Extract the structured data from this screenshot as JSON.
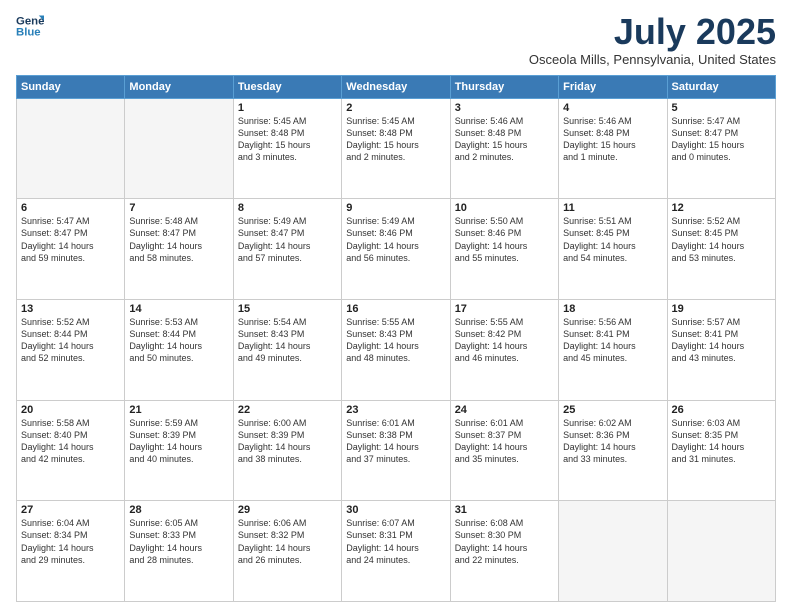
{
  "logo": {
    "line1": "General",
    "line2": "Blue"
  },
  "title": "July 2025",
  "location": "Osceola Mills, Pennsylvania, United States",
  "days_of_week": [
    "Sunday",
    "Monday",
    "Tuesday",
    "Wednesday",
    "Thursday",
    "Friday",
    "Saturday"
  ],
  "weeks": [
    [
      {
        "day": "",
        "info": ""
      },
      {
        "day": "",
        "info": ""
      },
      {
        "day": "1",
        "info": "Sunrise: 5:45 AM\nSunset: 8:48 PM\nDaylight: 15 hours\nand 3 minutes."
      },
      {
        "day": "2",
        "info": "Sunrise: 5:45 AM\nSunset: 8:48 PM\nDaylight: 15 hours\nand 2 minutes."
      },
      {
        "day": "3",
        "info": "Sunrise: 5:46 AM\nSunset: 8:48 PM\nDaylight: 15 hours\nand 2 minutes."
      },
      {
        "day": "4",
        "info": "Sunrise: 5:46 AM\nSunset: 8:48 PM\nDaylight: 15 hours\nand 1 minute."
      },
      {
        "day": "5",
        "info": "Sunrise: 5:47 AM\nSunset: 8:47 PM\nDaylight: 15 hours\nand 0 minutes."
      }
    ],
    [
      {
        "day": "6",
        "info": "Sunrise: 5:47 AM\nSunset: 8:47 PM\nDaylight: 14 hours\nand 59 minutes."
      },
      {
        "day": "7",
        "info": "Sunrise: 5:48 AM\nSunset: 8:47 PM\nDaylight: 14 hours\nand 58 minutes."
      },
      {
        "day": "8",
        "info": "Sunrise: 5:49 AM\nSunset: 8:47 PM\nDaylight: 14 hours\nand 57 minutes."
      },
      {
        "day": "9",
        "info": "Sunrise: 5:49 AM\nSunset: 8:46 PM\nDaylight: 14 hours\nand 56 minutes."
      },
      {
        "day": "10",
        "info": "Sunrise: 5:50 AM\nSunset: 8:46 PM\nDaylight: 14 hours\nand 55 minutes."
      },
      {
        "day": "11",
        "info": "Sunrise: 5:51 AM\nSunset: 8:45 PM\nDaylight: 14 hours\nand 54 minutes."
      },
      {
        "day": "12",
        "info": "Sunrise: 5:52 AM\nSunset: 8:45 PM\nDaylight: 14 hours\nand 53 minutes."
      }
    ],
    [
      {
        "day": "13",
        "info": "Sunrise: 5:52 AM\nSunset: 8:44 PM\nDaylight: 14 hours\nand 52 minutes."
      },
      {
        "day": "14",
        "info": "Sunrise: 5:53 AM\nSunset: 8:44 PM\nDaylight: 14 hours\nand 50 minutes."
      },
      {
        "day": "15",
        "info": "Sunrise: 5:54 AM\nSunset: 8:43 PM\nDaylight: 14 hours\nand 49 minutes."
      },
      {
        "day": "16",
        "info": "Sunrise: 5:55 AM\nSunset: 8:43 PM\nDaylight: 14 hours\nand 48 minutes."
      },
      {
        "day": "17",
        "info": "Sunrise: 5:55 AM\nSunset: 8:42 PM\nDaylight: 14 hours\nand 46 minutes."
      },
      {
        "day": "18",
        "info": "Sunrise: 5:56 AM\nSunset: 8:41 PM\nDaylight: 14 hours\nand 45 minutes."
      },
      {
        "day": "19",
        "info": "Sunrise: 5:57 AM\nSunset: 8:41 PM\nDaylight: 14 hours\nand 43 minutes."
      }
    ],
    [
      {
        "day": "20",
        "info": "Sunrise: 5:58 AM\nSunset: 8:40 PM\nDaylight: 14 hours\nand 42 minutes."
      },
      {
        "day": "21",
        "info": "Sunrise: 5:59 AM\nSunset: 8:39 PM\nDaylight: 14 hours\nand 40 minutes."
      },
      {
        "day": "22",
        "info": "Sunrise: 6:00 AM\nSunset: 8:39 PM\nDaylight: 14 hours\nand 38 minutes."
      },
      {
        "day": "23",
        "info": "Sunrise: 6:01 AM\nSunset: 8:38 PM\nDaylight: 14 hours\nand 37 minutes."
      },
      {
        "day": "24",
        "info": "Sunrise: 6:01 AM\nSunset: 8:37 PM\nDaylight: 14 hours\nand 35 minutes."
      },
      {
        "day": "25",
        "info": "Sunrise: 6:02 AM\nSunset: 8:36 PM\nDaylight: 14 hours\nand 33 minutes."
      },
      {
        "day": "26",
        "info": "Sunrise: 6:03 AM\nSunset: 8:35 PM\nDaylight: 14 hours\nand 31 minutes."
      }
    ],
    [
      {
        "day": "27",
        "info": "Sunrise: 6:04 AM\nSunset: 8:34 PM\nDaylight: 14 hours\nand 29 minutes."
      },
      {
        "day": "28",
        "info": "Sunrise: 6:05 AM\nSunset: 8:33 PM\nDaylight: 14 hours\nand 28 minutes."
      },
      {
        "day": "29",
        "info": "Sunrise: 6:06 AM\nSunset: 8:32 PM\nDaylight: 14 hours\nand 26 minutes."
      },
      {
        "day": "30",
        "info": "Sunrise: 6:07 AM\nSunset: 8:31 PM\nDaylight: 14 hours\nand 24 minutes."
      },
      {
        "day": "31",
        "info": "Sunrise: 6:08 AM\nSunset: 8:30 PM\nDaylight: 14 hours\nand 22 minutes."
      },
      {
        "day": "",
        "info": ""
      },
      {
        "day": "",
        "info": ""
      }
    ]
  ]
}
